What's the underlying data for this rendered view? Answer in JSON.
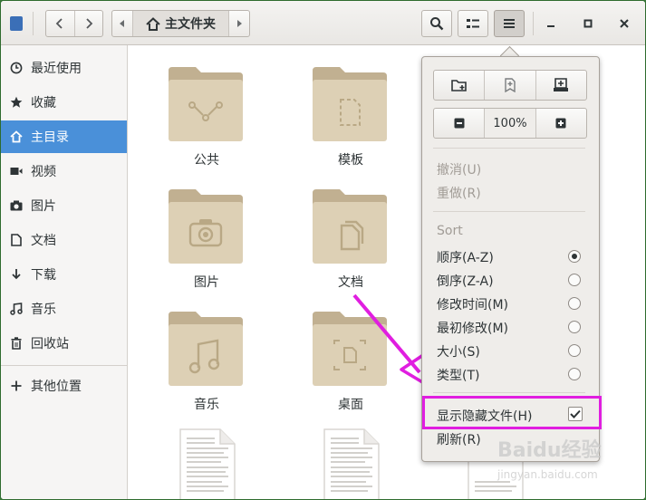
{
  "header": {
    "path_label": "主文件夹",
    "icons": {
      "app": "file-manager-icon",
      "back": "chevron-left-icon",
      "forward": "chevron-right-icon",
      "home": "home-icon",
      "search": "search-icon",
      "view": "list-view-icon",
      "menu": "hamburger-menu-icon",
      "minimize": "minimize-icon",
      "maximize": "maximize-icon",
      "close": "close-icon"
    }
  },
  "sidebar": {
    "items": [
      {
        "label": "最近使用",
        "icon": "clock-icon"
      },
      {
        "label": "收藏",
        "icon": "star-icon"
      },
      {
        "label": "主目录",
        "icon": "home-icon",
        "active": true
      },
      {
        "label": "视频",
        "icon": "video-icon"
      },
      {
        "label": "图片",
        "icon": "camera-icon"
      },
      {
        "label": "文档",
        "icon": "document-icon"
      },
      {
        "label": "下载",
        "icon": "download-icon"
      },
      {
        "label": "音乐",
        "icon": "music-icon"
      },
      {
        "label": "回收站",
        "icon": "trash-icon"
      }
    ],
    "other_locations": {
      "label": "其他位置",
      "icon": "plus-icon"
    }
  },
  "content": {
    "folders": [
      {
        "label": "公共",
        "icon": "share-folder-icon"
      },
      {
        "label": "模板",
        "icon": "template-folder-icon"
      },
      {
        "label": "图片",
        "icon": "pictures-folder-icon"
      },
      {
        "label": "文档",
        "icon": "documents-folder-icon"
      },
      {
        "label": "音乐",
        "icon": "music-folder-icon"
      },
      {
        "label": "桌面",
        "icon": "desktop-folder-icon"
      }
    ]
  },
  "menu": {
    "buttons": {
      "new_folder": "new-folder-icon",
      "bookmark": "bookmark-add-icon",
      "new_tab": "new-tab-icon",
      "zoom_out": "zoom-out-icon",
      "zoom_in": "zoom-in-icon"
    },
    "zoom_value": "100%",
    "undo": "撤消(U)",
    "redo": "重做(R)",
    "sort_header": "Sort",
    "sort_options": [
      {
        "label": "顺序(A-Z)",
        "selected": true
      },
      {
        "label": "倒序(Z-A)",
        "selected": false
      },
      {
        "label": "修改时间(M)",
        "selected": false
      },
      {
        "label": "最初修改(M)",
        "selected": false
      },
      {
        "label": "大小(S)",
        "selected": false
      },
      {
        "label": "类型(T)",
        "selected": false
      }
    ],
    "show_hidden": {
      "label": "显示隐藏文件(H)",
      "checked": true
    },
    "refresh": "刷新(R)"
  },
  "annotation": {
    "highlight_color": "#e01ee0",
    "arrow_color": "#e01ee0"
  },
  "colors": {
    "accent": "#4a90d9",
    "folder": "#d9ccb0",
    "folder_tab": "#c1b091"
  },
  "watermark": {
    "text": "Baidu经验",
    "sub": "jingyan.baidu.com"
  }
}
